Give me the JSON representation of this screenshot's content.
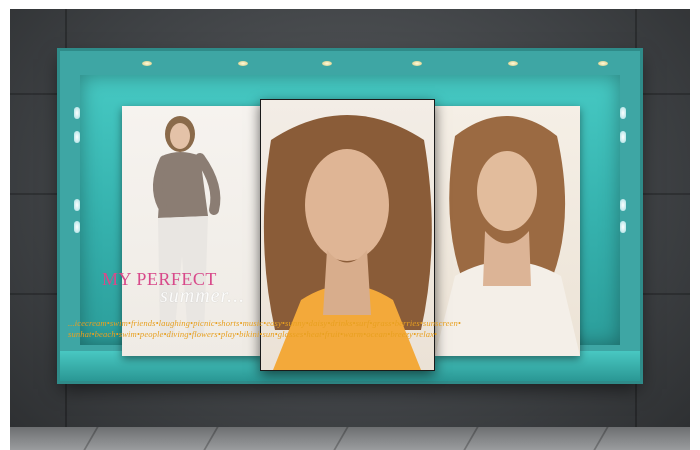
{
  "poster": {
    "title": "MY PERFECT",
    "script": "summer..."
  },
  "tagline": {
    "line1": "...icecream•swim•friends•laughing•picnic•shorts•music•easy•sunny•daisy•drinks•surf•grass•berries•sunscreen•",
    "line2": "sunhat•beach•swim•people•diving•flowers•play•bikini•sun•glasses•heat•fruit•warm•ocean•breezy•relax•"
  },
  "colors": {
    "showcase_teal": "#3ea6a4",
    "title_pink": "#d8498a",
    "tagline_orange": "#e8a020",
    "wall_gray": "#4a4d50"
  },
  "icons": {
    "display_lamp": "ceiling-spotlight",
    "side_light": "wall-led"
  }
}
